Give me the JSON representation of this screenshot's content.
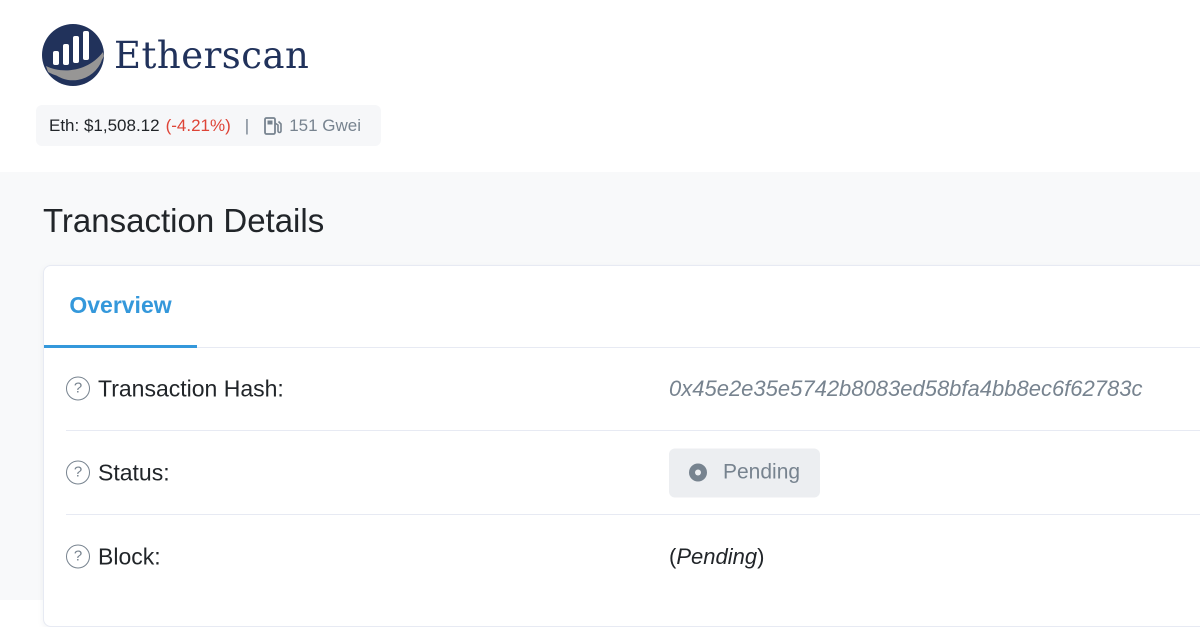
{
  "brand": {
    "name": "Etherscan",
    "colors": {
      "navy": "#21325b",
      "accent": "#3498db",
      "negative": "#de4437",
      "muted": "#77838f"
    }
  },
  "price_bar": {
    "eth_label": "Eth: $1,508.12",
    "eth_change": "(-4.21%)",
    "separator": "|",
    "gas_icon": "gas-pump-icon",
    "gas_value": "151 Gwei"
  },
  "page": {
    "title": "Transaction Details"
  },
  "tabs": [
    {
      "label": "Overview",
      "active": true
    }
  ],
  "details": {
    "help_icon_glyph": "?",
    "rows": [
      {
        "label": "Transaction Hash:",
        "value": "0x45e2e35e5742b8083ed58bfa4bb8ec6f62783c"
      },
      {
        "label": "Status:",
        "value": "Pending",
        "icon": "pending-icon"
      },
      {
        "label": "Block:",
        "value_open": "(",
        "value": "Pending",
        "value_close": ")"
      }
    ]
  }
}
